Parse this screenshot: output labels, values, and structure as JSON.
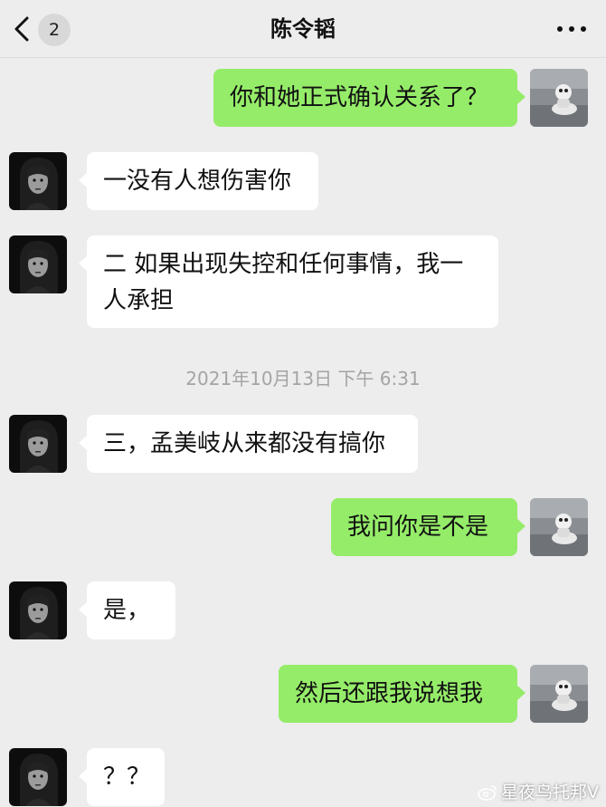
{
  "header": {
    "back_icon": "chevron-left-icon",
    "unread_count": "2",
    "title": "陈令韬",
    "more_icon": "more-dots-icon"
  },
  "messages": [
    {
      "side": "out",
      "text": "你和她正式确认关系了？",
      "avatar": "self-avatar"
    },
    {
      "side": "in",
      "text": "一没有人想伤害你",
      "avatar": "contact-avatar"
    },
    {
      "side": "in",
      "text": "二 如果出现失控和任何事情，我一人承担",
      "avatar": "contact-avatar"
    },
    {
      "type": "time",
      "text": "2021年10月13日 下午 6:31"
    },
    {
      "side": "in",
      "text": "三，孟美岐从来都没有搞你",
      "avatar": "contact-avatar"
    },
    {
      "side": "out",
      "text": "我问你是不是",
      "avatar": "self-avatar"
    },
    {
      "side": "in",
      "text": "是，",
      "avatar": "contact-avatar"
    },
    {
      "side": "out",
      "text": "然后还跟我说想我",
      "avatar": "self-avatar"
    },
    {
      "side": "in",
      "text": "？？",
      "avatar": "contact-avatar"
    }
  ],
  "watermark": "星夜鸟托邦V",
  "colors": {
    "background": "#ededed",
    "outgoing_bubble": "#95ec69",
    "incoming_bubble": "#ffffff",
    "timestamp": "#a4a4a4"
  }
}
